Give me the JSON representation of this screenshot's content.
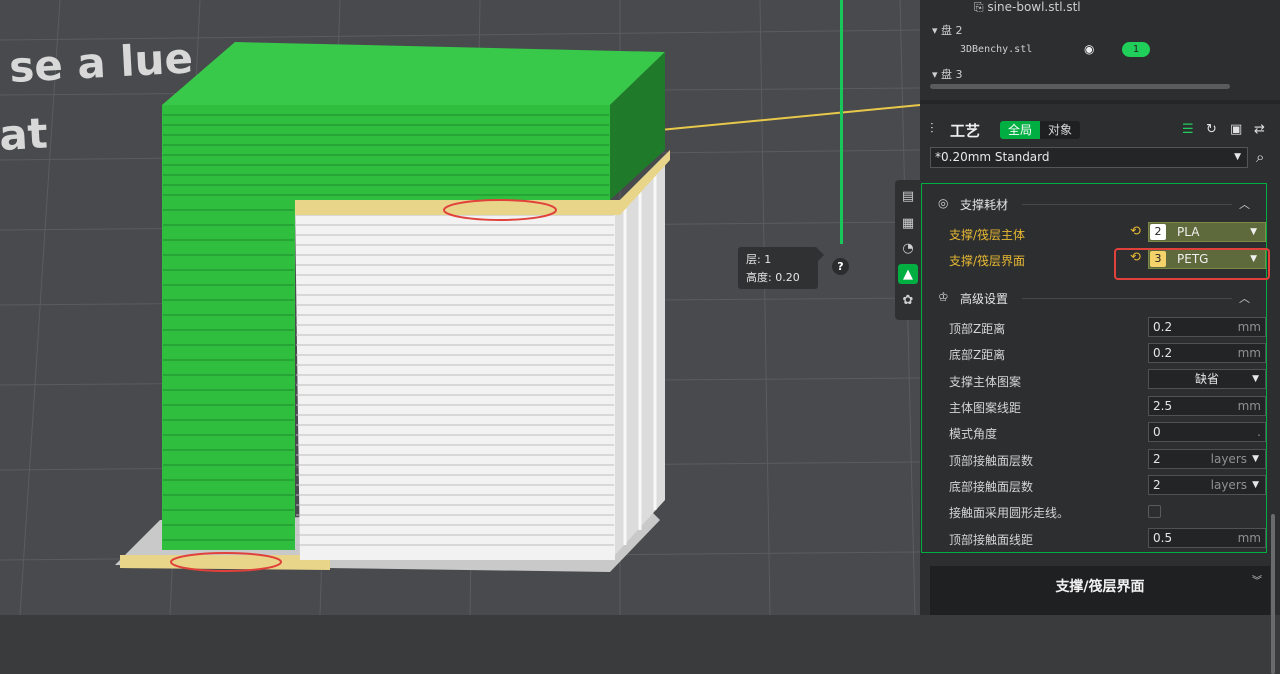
{
  "objects": {
    "file_item": "sine-bowl.stl.stl",
    "plate2_label": "盘 2",
    "plate2_object": "3DBenchy.stl",
    "plate2_object_badge": "1",
    "plate3_label": "盘 3"
  },
  "viewport": {
    "bed_text_line1": "se a  lue",
    "bed_text_line2": "at",
    "layer_label": "层: 1",
    "height_label": "高度: 0.20",
    "help_glyph": "?"
  },
  "process": {
    "title": "工艺",
    "tab_global": "全局",
    "tab_object": "对象",
    "preset": "*0.20mm Standard"
  },
  "support_filament": {
    "section_title": "支撑耗材",
    "body_label": "支撑/筏层主体",
    "body_filament_num": "2",
    "body_filament_name": "PLA",
    "body_filament_color": "#ffffff",
    "interface_label": "支撑/筏层界面",
    "interface_filament_num": "3",
    "interface_filament_name": "PETG",
    "interface_filament_color": "#f3d36a"
  },
  "advanced": {
    "section_title": "高级设置",
    "rows": [
      {
        "label": "顶部Z距离",
        "value": "0.2",
        "unit": "mm"
      },
      {
        "label": "底部Z距离",
        "value": "0.2",
        "unit": "mm"
      },
      {
        "label": "支撑主体图案",
        "value": "缺省"
      },
      {
        "label": "主体图案线距",
        "value": "2.5",
        "unit": "mm"
      },
      {
        "label": "模式角度",
        "value": "0",
        "unit": "."
      },
      {
        "label": "顶部接触面层数",
        "value": "2",
        "unit": "layers"
      },
      {
        "label": "底部接触面层数",
        "value": "2",
        "unit": "layers"
      },
      {
        "label": "接触面采用圆形走线。"
      },
      {
        "label": "顶部接触面线距",
        "value": "0.5",
        "unit": "mm"
      }
    ]
  },
  "help_card": {
    "title": "支撑/筏层界面"
  },
  "colors": {
    "accent": "#00ae42",
    "highlight": "#e0413a",
    "modified": "#e6b833"
  }
}
